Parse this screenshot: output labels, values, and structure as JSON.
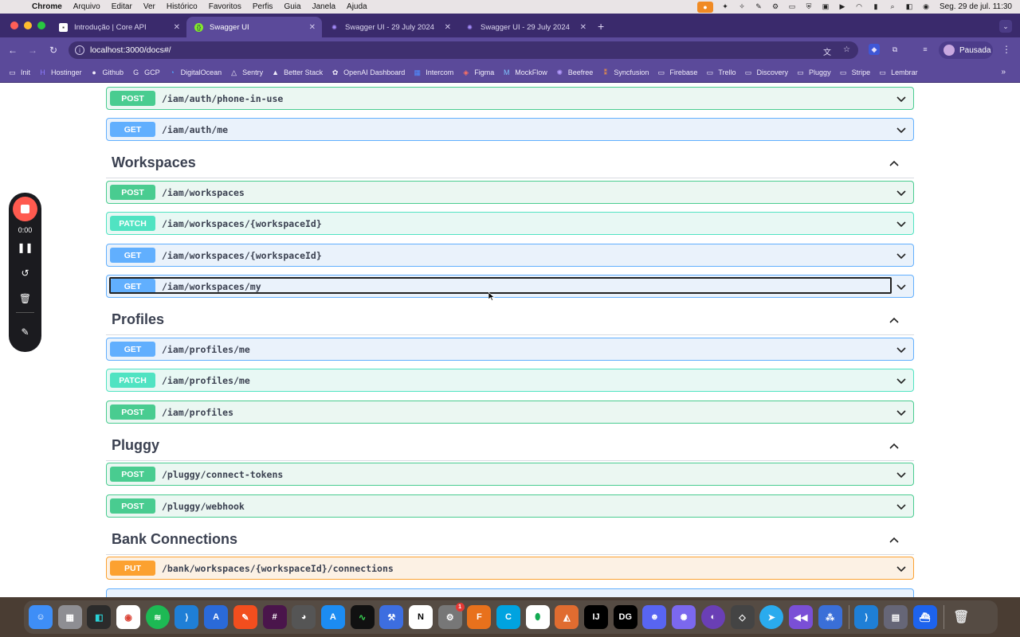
{
  "menubar": {
    "app": "Chrome",
    "items": [
      "Arquivo",
      "Editar",
      "Ver",
      "Histórico",
      "Favoritos",
      "Perfis",
      "Guia",
      "Janela",
      "Ajuda"
    ],
    "clock": "Seg. 29 de jul.  11:30"
  },
  "tabs": [
    {
      "title": "Introdução | Core API",
      "icon": "core-api-favicon"
    },
    {
      "title": "Swagger UI",
      "icon": "swagger-favicon"
    },
    {
      "title": "Swagger UI - 29 July 2024",
      "icon": "swagger-favicon"
    },
    {
      "title": "Swagger UI - 29 July 2024",
      "icon": "swagger-favicon"
    }
  ],
  "toolbar": {
    "url": "localhost:3000/docs#/",
    "profile_label": "Pausada"
  },
  "bookmarks": [
    "Init",
    "Hostinger",
    "Github",
    "GCP",
    "DigitalOcean",
    "Sentry",
    "Better Stack",
    "OpenAI Dashboard",
    "Intercom",
    "Figma",
    "MockFlow",
    "Beefree",
    "Syncfusion",
    "Firebase",
    "Trello",
    "Discovery",
    "Pluggy",
    "Stripe",
    "Lembrar"
  ],
  "swagger": {
    "ops_top": [
      {
        "method": "POST",
        "path": "/iam/auth/phone-in-use"
      },
      {
        "method": "GET",
        "path": "/iam/auth/me"
      }
    ],
    "sections": [
      {
        "title": "Workspaces",
        "ops": [
          {
            "method": "POST",
            "path": "/iam/workspaces"
          },
          {
            "method": "PATCH",
            "path": "/iam/workspaces/{workspaceId}"
          },
          {
            "method": "GET",
            "path": "/iam/workspaces/{workspaceId}"
          },
          {
            "method": "GET",
            "path": "/iam/workspaces/my"
          }
        ]
      },
      {
        "title": "Profiles",
        "ops": [
          {
            "method": "GET",
            "path": "/iam/profiles/me"
          },
          {
            "method": "PATCH",
            "path": "/iam/profiles/me"
          },
          {
            "method": "POST",
            "path": "/iam/profiles"
          }
        ]
      },
      {
        "title": "Pluggy",
        "ops": [
          {
            "method": "POST",
            "path": "/pluggy/connect-tokens"
          },
          {
            "method": "POST",
            "path": "/pluggy/webhook"
          }
        ]
      },
      {
        "title": "Bank Connections",
        "ops": [
          {
            "method": "PUT",
            "path": "/bank/workspaces/{workspaceId}/connections"
          }
        ]
      }
    ]
  },
  "recorder": {
    "time": "0:00"
  },
  "dock": {
    "mail_badge": "1"
  },
  "colors": {
    "post": "#49cc90",
    "get": "#61affe",
    "patch": "#50e3c2",
    "put": "#fca130",
    "chrome_theme": "#5b4a9a",
    "record": "#ff5a4f"
  }
}
